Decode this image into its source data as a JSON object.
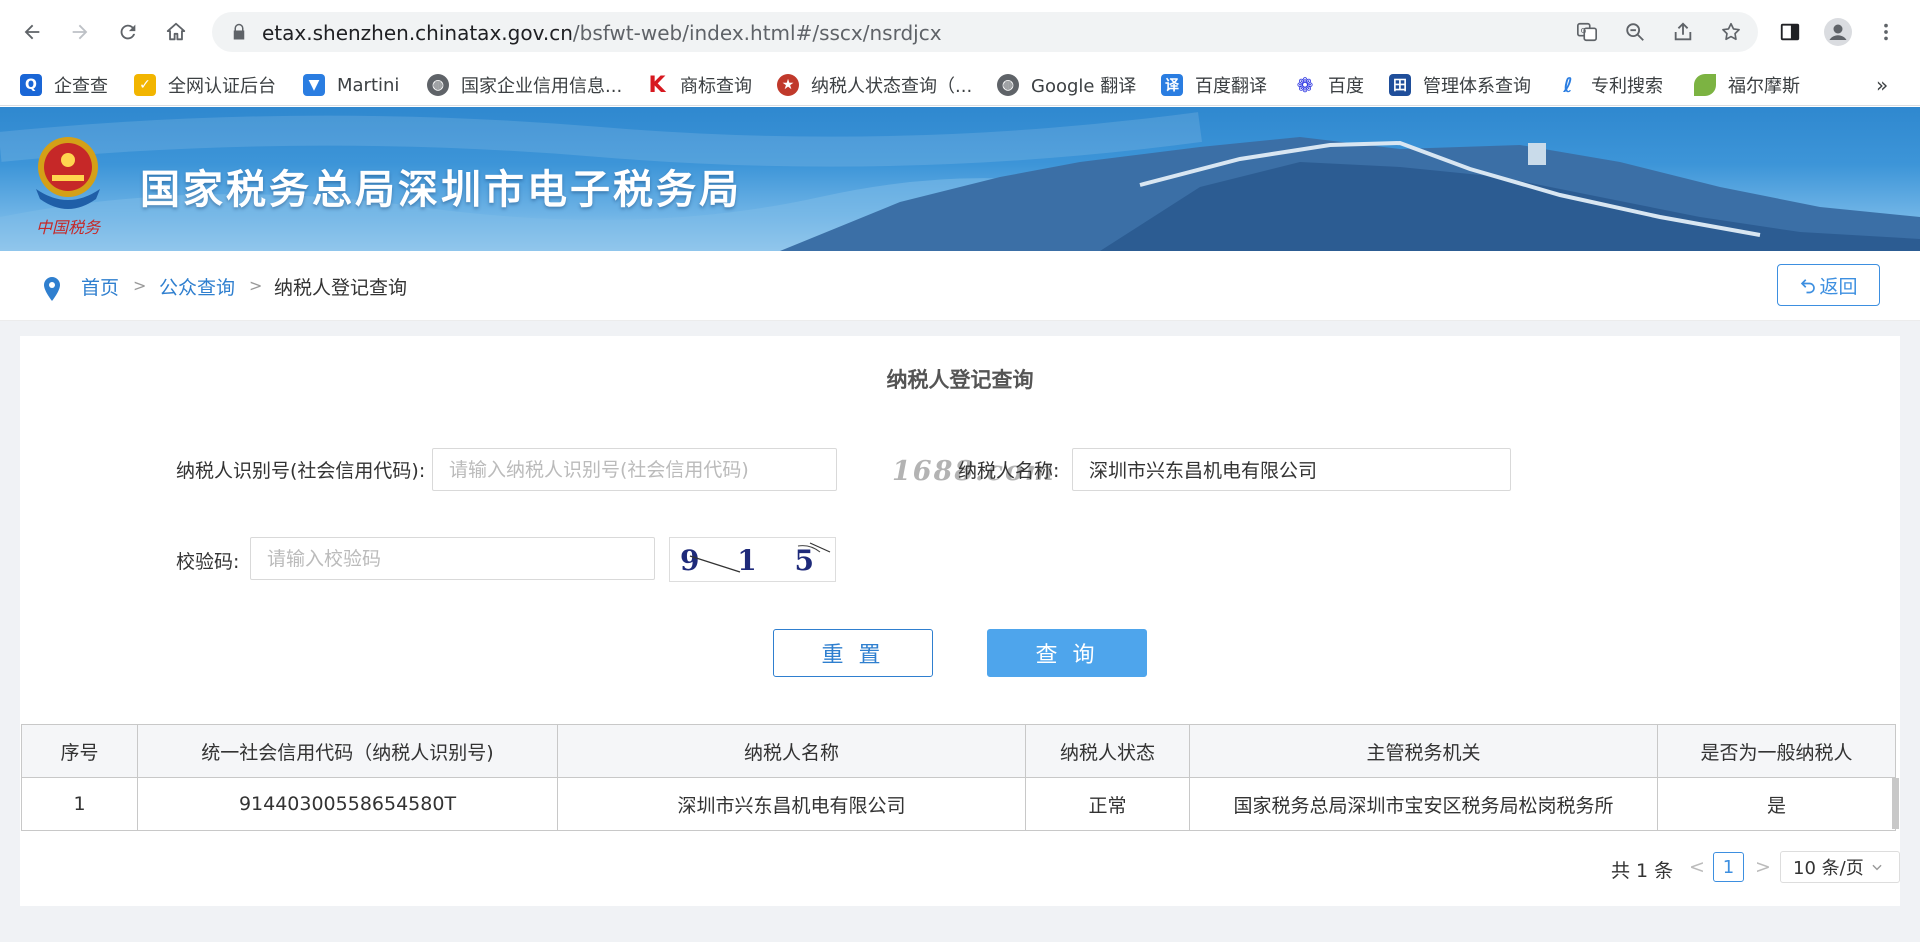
{
  "browser": {
    "url_host": "etax.shenzhen.chinatax.gov.cn",
    "url_path": "/bsfwt-web/index.html#/sscx/nsrdjcx"
  },
  "bookmarks": [
    {
      "label": "企查查",
      "color": "#1a66d6"
    },
    {
      "label": "全网认证后台",
      "color": "#f2b500"
    },
    {
      "label": "Martini",
      "color": "#2a7de1"
    },
    {
      "label": "国家企业信用信息...",
      "color": "#5f6368"
    },
    {
      "label": "商标查询",
      "color": "#d71920"
    },
    {
      "label": "纳税人状态查询（...",
      "color": "#c0392b"
    },
    {
      "label": "Google 翻译",
      "color": "#5f6368"
    },
    {
      "label": "百度翻译",
      "color": "#2a7de1"
    },
    {
      "label": "百度",
      "color": "#2932e1"
    },
    {
      "label": "管理体系查询",
      "color": "#1f4e9a"
    },
    {
      "label": "专利搜索",
      "color": "#2a7de1"
    },
    {
      "label": "福尔摩斯",
      "color": "#7cb342"
    }
  ],
  "bookmarks_more": "»",
  "banner": {
    "title": "国家税务总局深圳市电子税务局",
    "emblem_text": "中国税务"
  },
  "breadcrumb": {
    "home": "首页",
    "sep": ">",
    "public_query": "公众查询",
    "current": "纳税人登记查询"
  },
  "back_button": "返回",
  "form": {
    "title": "纳税人登记查询",
    "taxpayer_id_label": "纳税人识别号(社会信用代码):",
    "taxpayer_id_placeholder": "请输入纳税人识别号(社会信用代码)",
    "taxpayer_id_value": "",
    "taxpayer_name_label": "纳税人名称:",
    "taxpayer_name_value": "深圳市兴东昌机电有限公司",
    "captcha_label": "校验码:",
    "captcha_placeholder": "请输入校验码",
    "captcha_value": "",
    "captcha_image_text": "9 1 5 1",
    "watermark": "1688.com",
    "reset_button": "重 置",
    "query_button": "查 询"
  },
  "table": {
    "headers": [
      "序号",
      "统一社会信用代码（纳税人识别号)",
      "纳税人名称",
      "纳税人状态",
      "主管税务机关",
      "是否为一般纳税人"
    ],
    "rows": [
      [
        "1",
        "91440300558654580T",
        "深圳市兴东昌机电有限公司",
        "正常",
        "国家税务总局深圳市宝安区税务局松岗税务所",
        "是"
      ]
    ]
  },
  "pagination": {
    "total": "共 1 条",
    "prev": "<",
    "current_page": "1",
    "next": ">",
    "page_size": "10 条/页"
  }
}
